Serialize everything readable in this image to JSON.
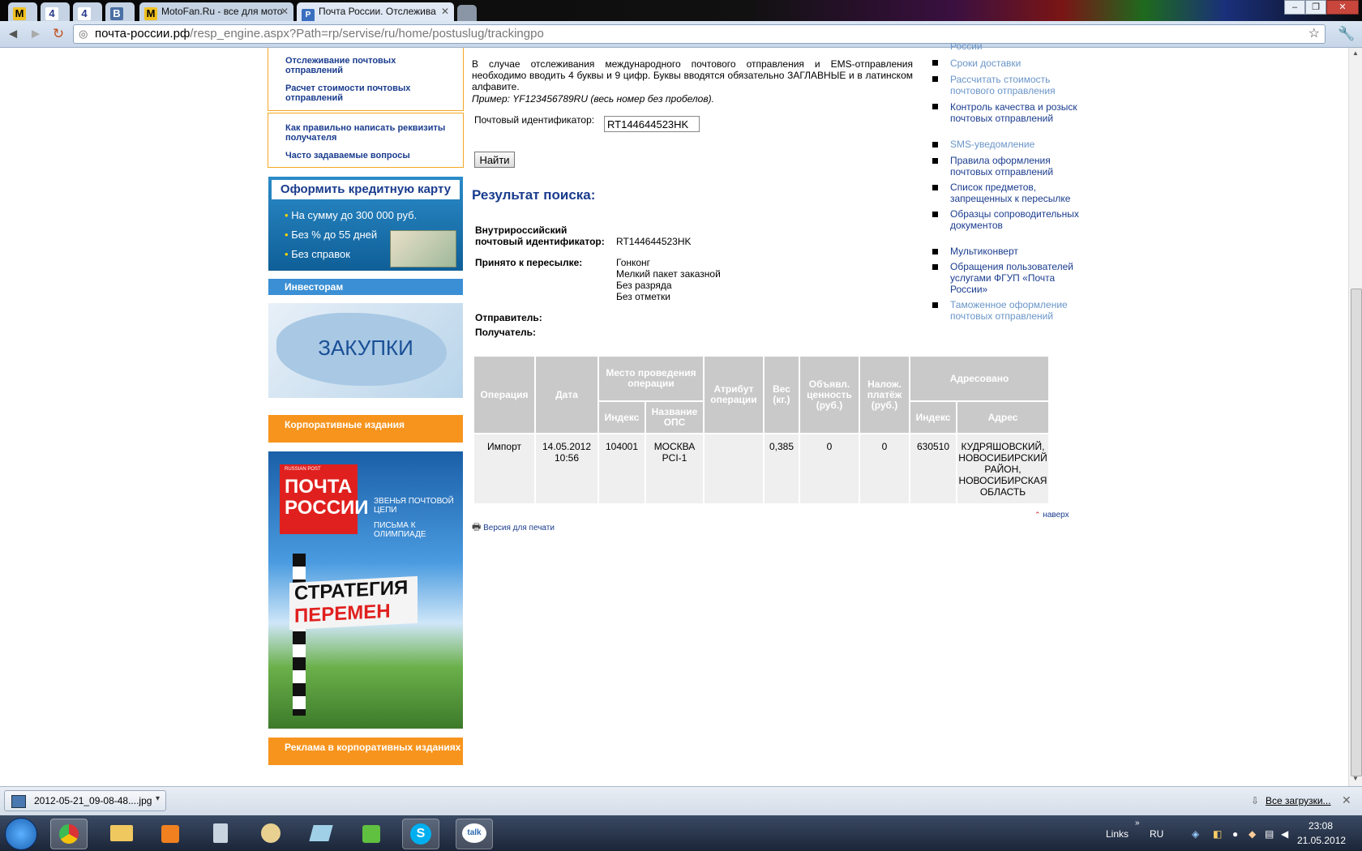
{
  "browser": {
    "tabs": [
      {
        "icon": "M",
        "label": ""
      },
      {
        "icon": "4",
        "label": ""
      },
      {
        "icon": "4",
        "label": ""
      },
      {
        "icon": "B",
        "label": ""
      },
      {
        "icon": "M",
        "label": "MotoFan.Ru - все для мото"
      },
      {
        "icon": "P",
        "label": "Почта России. Отслежива"
      }
    ],
    "url_host": "почта-россии.рф",
    "url_path": "/resp_engine.aspx?Path=rp/servise/ru/home/postuslug/trackingpo"
  },
  "left": {
    "links_top": [
      "Отслеживание почтовых отправлений",
      "Расчет стоимости почтовых отправлений"
    ],
    "links_help": [
      "Как правильно написать реквизиты получателя",
      "Часто задаваемые вопросы"
    ],
    "credit": {
      "title": "Оформить кредитную карту",
      "items": [
        "На сумму до 300 000 руб.",
        "Без % до 55 дней",
        "Без справок"
      ]
    },
    "investors": "Инвесторам",
    "zakupki": "ЗАКУПКИ",
    "corporate": "Корпоративные издания",
    "poster": {
      "small": "RUSSIAN POST",
      "brand": "ПОЧТА РОССИИ",
      "line1": "ЗВЕНЬЯ ПОЧТОВОЙ ЦЕПИ",
      "line2": "ПИСЬМА К ОЛИМПИАДЕ",
      "title1": "СТРАТЕГИЯ",
      "title2": "ПЕРЕМЕН"
    },
    "ads": "Реклама в корпоративных изданиях"
  },
  "main": {
    "intro": "В случае отслеживания международного почтового отправления и EMS-отправления необходимо вводить 4 буквы и 9 цифр. Буквы вводятся обязательно ЗАГЛАВНЫЕ и в латинском алфавите.",
    "example": "Пример: YF123456789RU (весь номер без пробелов).",
    "id_label": "Почтовый идентификатор:",
    "id_value": "RT144644523HK",
    "find_button": "Найти",
    "result_title": "Результат поиска:",
    "domestic_label1": "Внутрироссийский",
    "domestic_label2": "почтовый идентификатор:",
    "domestic_value": "RT144644523HK",
    "accepted_label": "Принято к пересылке:",
    "accepted_values": [
      "Гонконг",
      "Мелкий пакет заказной",
      "Без разряда",
      "Без отметки"
    ],
    "sender_label": "Отправитель:",
    "recipient_label": "Получатель:",
    "table": {
      "headers": {
        "operation": "Операция",
        "date": "Дата",
        "place": "Место проведения операции",
        "index": "Индекс",
        "ops_name": "Название ОПС",
        "attr": "Атрибут операции",
        "weight": "Вес (кг.)",
        "declared": "Объявл. ценность (руб.)",
        "cod": "Налож. платёж (руб.)",
        "addressed": "Адресовано",
        "addr_index": "Индекс",
        "address": "Адрес"
      },
      "row": {
        "operation": "Импорт",
        "date": "14.05.2012 10:56",
        "index": "104001",
        "ops_name": "МОСКВА PCI-1",
        "attr": "",
        "weight": "0,385",
        "declared": "0",
        "cod": "0",
        "addr_index": "630510",
        "address": "КУДРЯШОВСКИЙ, НОВОСИБИРСКИЙ РАЙОН, НОВОСИБИРСКАЯ ОБЛАСТЬ"
      }
    },
    "print_link": "Версия для печати",
    "top_link": "наверх"
  },
  "right_menu": [
    {
      "label": "России",
      "style": "light"
    },
    {
      "label": "Сроки доставки",
      "style": "light"
    },
    {
      "label": "Рассчитать стоимость почтового отправления",
      "style": "light"
    },
    {
      "label": "Контроль качества и розыск почтовых отправлений",
      "style": "dark"
    },
    {
      "label": "SMS-уведомление",
      "style": "light"
    },
    {
      "label": "Правила оформления почтовых отправлений",
      "style": "dark"
    },
    {
      "label": "Список предметов, запрещенных к пересылке",
      "style": "dark"
    },
    {
      "label": "Образцы сопроводительных документов",
      "style": "dark"
    },
    {
      "label": "Мультиконверт",
      "style": "dark"
    },
    {
      "label": "Обращения пользователей услугами ФГУП «Почта России»",
      "style": "dark"
    },
    {
      "label": "Таможенное оформление почтовых отправлений",
      "style": "light"
    }
  ],
  "download_bar": {
    "file": "2012-05-21_09-08-48....jpg",
    "all": "Все загрузки..."
  },
  "taskbar": {
    "links": "Links",
    "lang": "RU",
    "time": "23:08",
    "date": "21.05.2012"
  }
}
